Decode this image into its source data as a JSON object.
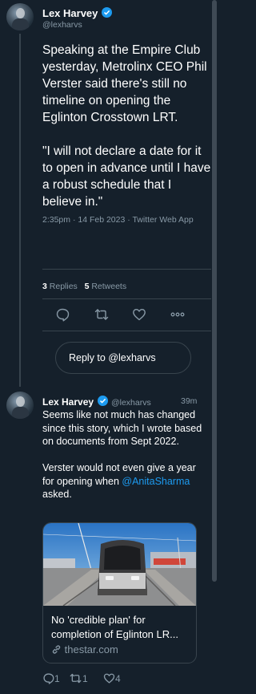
{
  "main_tweet": {
    "author_name": "Lex Harvey",
    "handle": "@lexharvs",
    "paragraph1": "Speaking at the Empire Club yesterday, Metrolinx CEO Phil Verster said there's still no timeline on opening the Eglinton Crosstown LRT.",
    "paragraph2": "\"I will not declare a date for it to open in advance until I have a robust schedule that I believe in.\"",
    "meta": "2:35pm · 14 Feb 2023 · Twitter Web App",
    "replies_count": "3",
    "replies_label": "Replies",
    "retweets_count": "5",
    "retweets_label": "Retweets"
  },
  "reply_box": {
    "label": "Reply to @lexharvs"
  },
  "reply_tweet": {
    "author_name": "Lex Harvey",
    "handle": "@lexharvs",
    "time": "39m",
    "paragraph1": "Seems like not much has changed since this story, which I wrote based on documents from Sept 2022.",
    "paragraph2_prefix": "Verster would not even give a year for opening when ",
    "mention": "@AnitaSharma",
    "paragraph2_suffix": " asked.",
    "card": {
      "title": "No 'credible plan' for completion of Eglinton LR...",
      "domain": "thestar.com"
    },
    "counts": {
      "replies": "1",
      "retweets": "1",
      "likes": "4"
    }
  },
  "colors": {
    "background": "#15202b",
    "accent": "#1d9bf0",
    "muted": "#8899a6",
    "border": "#38444d"
  },
  "icons": [
    "verified-badge-icon",
    "reply-icon",
    "retweet-icon",
    "like-icon",
    "more-icon",
    "link-icon"
  ]
}
